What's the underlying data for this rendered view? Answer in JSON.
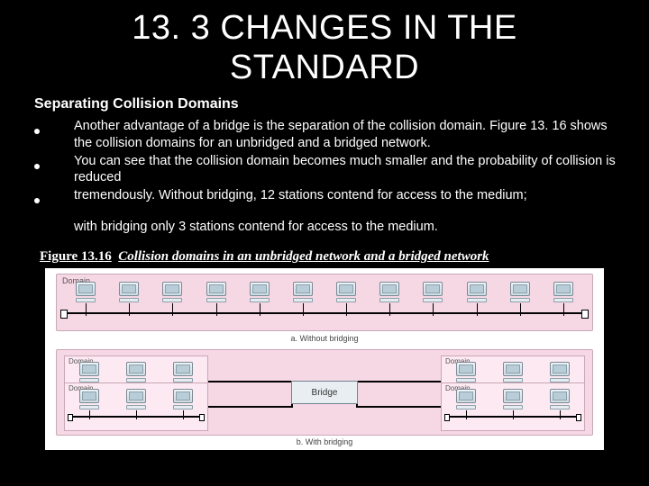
{
  "title": "13. 3 CHANGES IN THE STANDARD",
  "subheading": "Separating Collision Domains",
  "bullets": [
    "Another advantage of a bridge is the separation of the collision domain. Figure 13. 16 shows the collision domains for an unbridged and a bridged network.",
    "You can see that the collision domain becomes much smaller and the probability of collision is reduced",
    "tremendously. Without bridging, 12 stations contend for access to the medium;"
  ],
  "afterBullets": "with bridging only 3 stations contend for access to the medium.",
  "figure": {
    "label": "Figure 13.16",
    "title": "Collision domains in an unbridged network and a bridged network",
    "domainLabel": "Domain",
    "bridgeLabel": "Bridge",
    "captionA": "a. Without bridging",
    "captionB": "b. With bridging"
  }
}
